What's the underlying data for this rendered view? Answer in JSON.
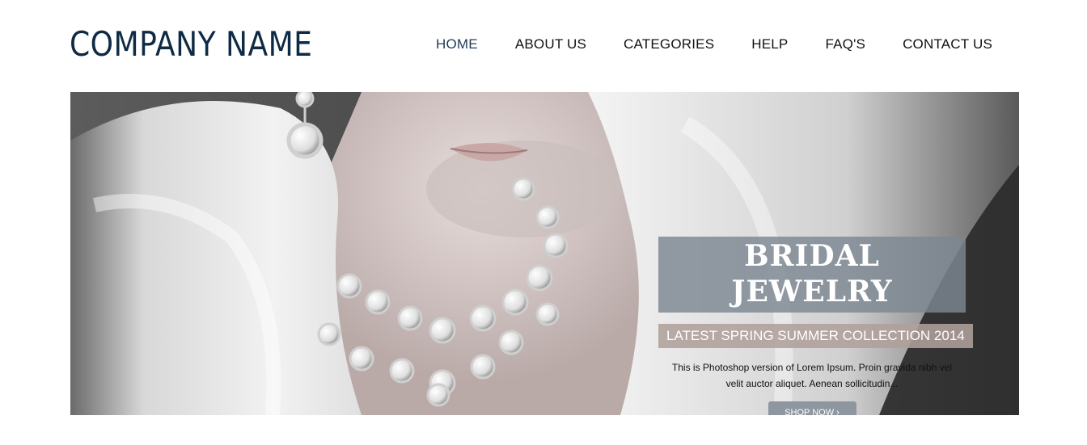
{
  "header": {
    "logo_text": "COMPANY NAME",
    "nav": [
      {
        "label": "HOME",
        "active": true
      },
      {
        "label": "ABOUT US"
      },
      {
        "label": "CATEGORIES"
      },
      {
        "label": "HELP"
      },
      {
        "label": "FAQ'S"
      },
      {
        "label": "CONTACT US"
      }
    ]
  },
  "hero": {
    "title": "BRIDAL JEWELRY",
    "subtitle": "LATEST SPRING SUMMER COLLECTION 2014",
    "description": "This is Photoshop version of Lorem Ipsum. Proin gravida nibh vel velit auctor aliquet. Aenean sollicitudin...",
    "button_label": "SHOP NOW ›"
  },
  "colors": {
    "logo": "#0f2a44",
    "nav_active": "#1f3a5a",
    "title_bg": "#7d8791",
    "subtitle_bg": "#afa09b",
    "button_bg": "#8e979f"
  }
}
